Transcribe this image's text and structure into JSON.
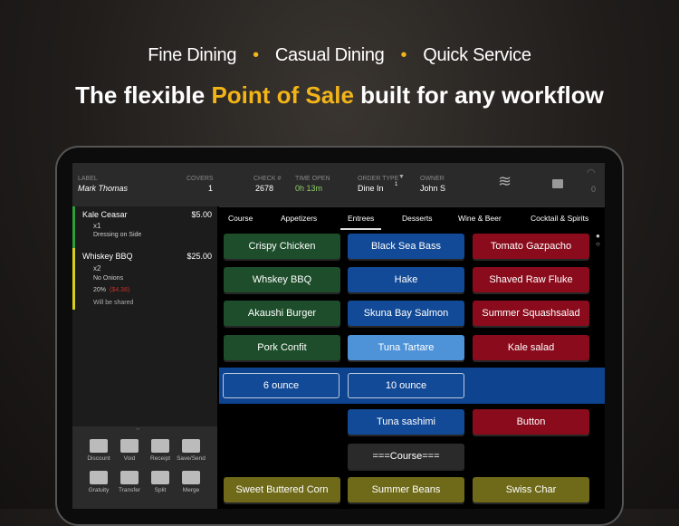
{
  "tagline": {
    "items": [
      "Fine Dining",
      "Casual Dining",
      "Quick Service"
    ],
    "separator": "•"
  },
  "headline": {
    "pre": "The flexible ",
    "highlight": "Point of Sale",
    "post": " built for any workflow"
  },
  "header": {
    "label_title": "LABEL",
    "label_value": "Mark Thomas",
    "covers_title": "COVERS",
    "covers_value": "1",
    "check_title": "CHECK #",
    "check_value": "2678",
    "time_title": "TIME OPEN",
    "time_value": "0h 13m",
    "order_type_title": "ORDER TYPE",
    "order_type_value": "Dine In",
    "order_type_sup": "1",
    "owner_title": "OWNER",
    "owner_value": "John S",
    "wifi_count": "0"
  },
  "order": [
    {
      "name": "Kale Ceasar",
      "price": "$5.00",
      "qty": "x1",
      "mods": [
        "Dressing on Side"
      ],
      "color": "#2e9e3a"
    },
    {
      "name": "Whiskey BBQ",
      "price": "$25.00",
      "qty": "x2",
      "mods": [
        "No Onions"
      ],
      "discount": "20%",
      "discount_amt": "($4.38)",
      "note": "Will be shared",
      "color": "#d8d020"
    }
  ],
  "tools": [
    "Discount",
    "Void",
    "Receipt",
    "Save/Send",
    "Gratuity",
    "Transfer",
    "Split",
    "Merge"
  ],
  "tabs": [
    "Course",
    "Appetizers",
    "Entrees",
    "Desserts",
    "Wine & Beer",
    "Cocktail & Spirits"
  ],
  "active_tab": "Entrees",
  "menu": {
    "rows": [
      [
        "Crispy Chicken",
        "Black Sea Bass",
        "Tomato Gazpacho"
      ],
      [
        "Whskey BBQ",
        "Hake",
        "Shaved Raw Fluke"
      ],
      [
        "Akaushi Burger",
        "Skuna Bay Salmon",
        "Summer Squashsalad"
      ],
      [
        "Pork Confit",
        "Tuna Tartare",
        "Kale salad"
      ]
    ],
    "options": [
      "6 ounce",
      "10 ounce"
    ],
    "extra": [
      "Tuna sashimi",
      "Button"
    ],
    "course": "===Course===",
    "bottom": [
      "Sweet Buttered Corn",
      "Summer Beans",
      "Swiss Char"
    ]
  }
}
